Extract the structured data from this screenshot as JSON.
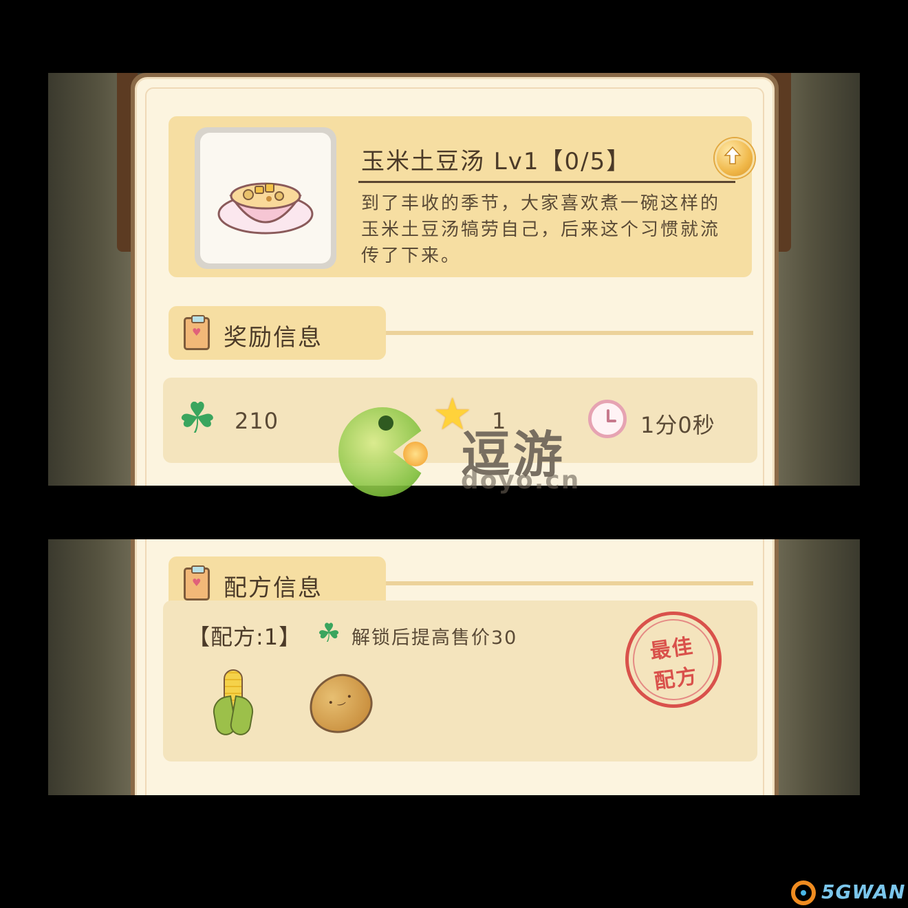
{
  "dish": {
    "title": "玉米土豆汤 Lv1【0/5】",
    "description": "到了丰收的季节，大家喜欢煮一碗这样的玉米土豆汤犒劳自己，后来这个习惯就流传了下来。"
  },
  "reward_section": {
    "label": "奖励信息",
    "clover_value": "210",
    "star_value": "1",
    "time_value": "1分0秒"
  },
  "recipe_section": {
    "label": "配方信息",
    "recipe_label": "【配方:1】",
    "bonus_text": "解锁后提高售价30",
    "ingredients": [
      "corn-icon",
      "potato-icon"
    ],
    "stamp_line1": "最佳",
    "stamp_line2": "配方"
  },
  "watermark": {
    "text": "逗游",
    "url": "doyo.cn"
  },
  "corner_logo": "5GWAN",
  "colors": {
    "panel": "#fcf4df",
    "card": "#f6dea2",
    "clover": "#3aa55e",
    "stamp": "#d9514b"
  }
}
